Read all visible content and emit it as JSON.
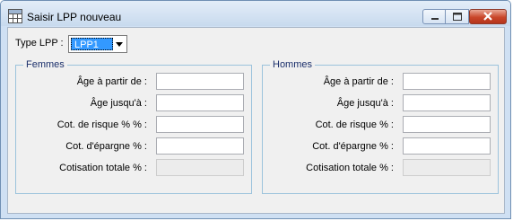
{
  "window": {
    "title": "Saisir LPP nouveau"
  },
  "type_lpp": {
    "label": "Type LPP :",
    "value": "LPP1"
  },
  "groups": [
    {
      "title": "Femmes",
      "rows": [
        {
          "label": "Âge à partir de :",
          "value": ""
        },
        {
          "label": "Âge jusqu'à :",
          "value": ""
        },
        {
          "label": "Cot. de risque % % :",
          "value": ""
        },
        {
          "label": "Cot. d'épargne % :",
          "value": ""
        },
        {
          "label": "Cotisation totale  % :",
          "value": ""
        }
      ]
    },
    {
      "title": "Hommes",
      "rows": [
        {
          "label": "Âge à partir de :",
          "value": ""
        },
        {
          "label": "Âge jusqu'à :",
          "value": ""
        },
        {
          "label": "Cot. de risque % :",
          "value": ""
        },
        {
          "label": "Cot. d'épargne % :",
          "value": ""
        },
        {
          "label": "Cotisation totale  % :",
          "value": ""
        }
      ]
    }
  ]
}
